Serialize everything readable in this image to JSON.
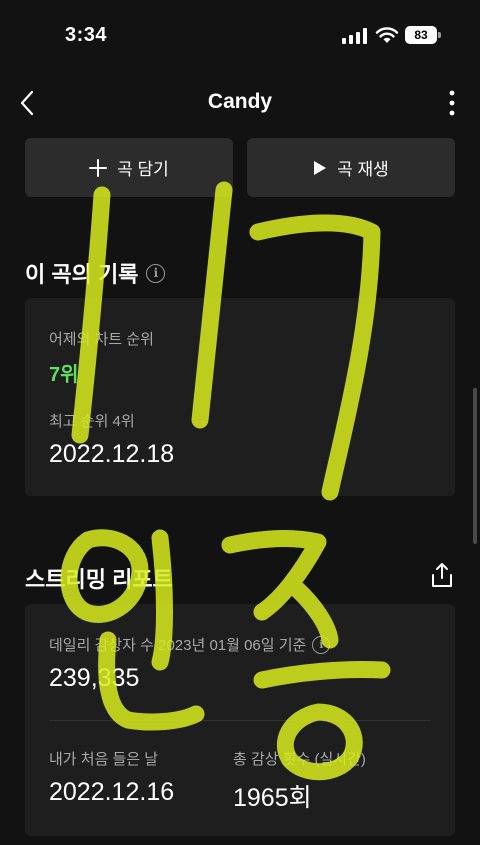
{
  "status": {
    "time": "3:34",
    "battery": "83"
  },
  "nav": {
    "title": "Candy"
  },
  "actions": {
    "add_label": "곡 담기",
    "play_label": "곡 재생"
  },
  "record": {
    "title": "이 곡의 기록",
    "yesterday_label": "어제의 차트 순위",
    "yesterday_rank": "7위",
    "best_label": "최고 순위 4위",
    "best_date": "2022.12.18"
  },
  "streaming": {
    "title": "스트리밍 리포트",
    "daily_label": "데일리 감상자 수 2023년 01월 06일 기준",
    "daily_value": "239,335",
    "first_label": "내가 처음 들은 날",
    "first_date": "2022.12.16",
    "total_label": "총 감상 횟수 (실시간)",
    "total_value": "1965회"
  },
  "overlay": {
    "scribble_color": "#d8ec1e"
  }
}
